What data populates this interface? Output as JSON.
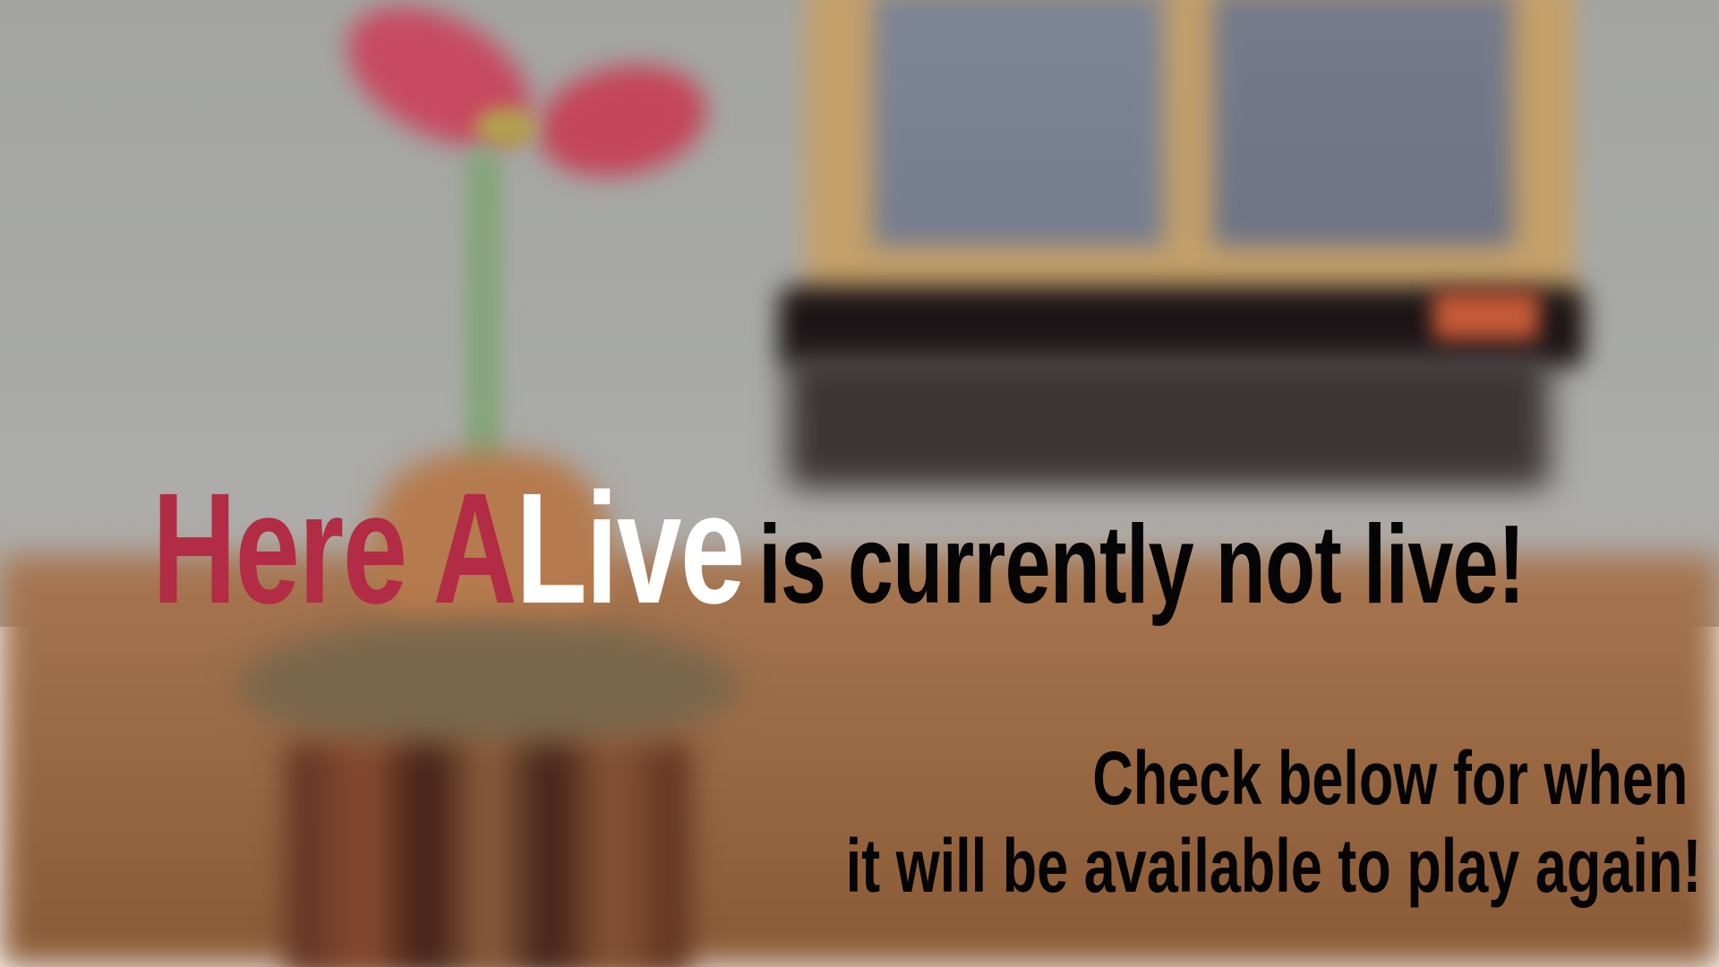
{
  "headline": {
    "part_red": "Here A",
    "part_white": "Live",
    "part_black": "is currently not live!"
  },
  "subheadline": {
    "line1": "Check below for when",
    "line2": "it will be available to play again!"
  },
  "colors": {
    "accent_red": "#b12c44",
    "accent_white": "#ffffff",
    "text_black": "#050505"
  },
  "background": {
    "description_elements": [
      "flower-in-pot",
      "side-table",
      "window",
      "window-sill",
      "wall",
      "wooden-floor"
    ],
    "blurred": true
  }
}
